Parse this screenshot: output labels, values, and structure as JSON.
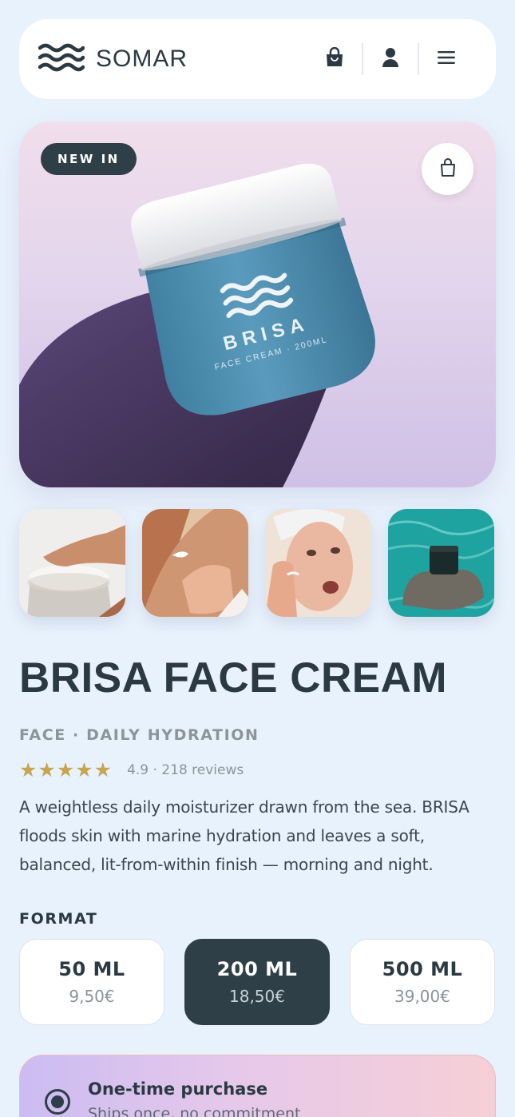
{
  "header": {
    "brand": "SOMAR",
    "logo_icon": "waves-icon",
    "actions": [
      {
        "name": "shopping-bag-icon"
      },
      {
        "name": "user-icon"
      },
      {
        "name": "menu-icon"
      }
    ]
  },
  "hero": {
    "badge": "NEW IN",
    "cart_icon": "shopping-bag-icon",
    "jar_brand": "BRISA",
    "jar_subtitle": "FACE CREAM · 200ML"
  },
  "thumbnails": [
    {
      "name": "thumbnail-cream-jar"
    },
    {
      "name": "thumbnail-arm-application"
    },
    {
      "name": "thumbnail-face-application"
    },
    {
      "name": "thumbnail-jar-on-rock"
    }
  ],
  "product": {
    "title": "BRISA FACE CREAM",
    "subtitle": "FACE · DAILY HYDRATION",
    "stars": "★★★★★",
    "rating_value": 4.9,
    "rating_text": "4.9 · 218 reviews",
    "description": "A weightless daily moisturizer drawn from the sea. BRISA floods skin with marine hydration and leaves a soft, balanced, lit-from-within finish — morning and night."
  },
  "format": {
    "label": "FORMAT",
    "options": [
      {
        "size": "50 ML",
        "price": "9,50€",
        "selected": false
      },
      {
        "size": "200 ML",
        "price": "18,50€",
        "selected": true
      },
      {
        "size": "500 ML",
        "price": "39,00€",
        "selected": false
      }
    ]
  },
  "purchase_option": {
    "title": "One-time purchase",
    "subtitle": "Ships once, no commitment",
    "selected": true
  },
  "colors": {
    "background": "#e8f2fc",
    "dark": "#2e3f47",
    "star": "#c9a451",
    "muted": "#8a949a"
  }
}
